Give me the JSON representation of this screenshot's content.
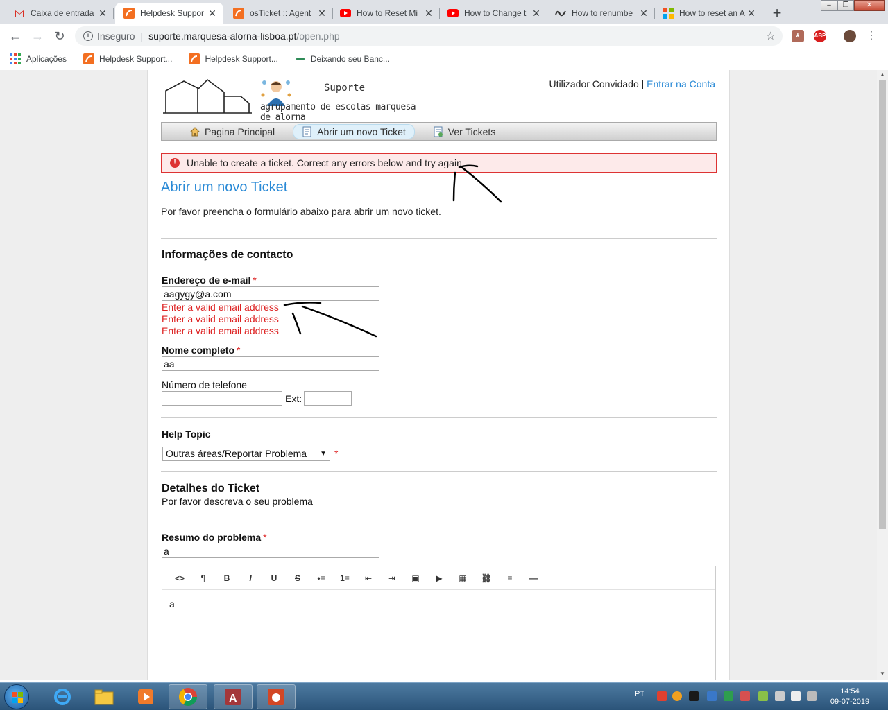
{
  "browser": {
    "tabs": [
      {
        "title": "Caixa de entrada",
        "icon": "gmail-icon",
        "active": false
      },
      {
        "title": "Helpdesk Suppor",
        "icon": "osticket-icon",
        "active": true
      },
      {
        "title": "osTicket :: Agent",
        "icon": "osticket-icon",
        "active": false
      },
      {
        "title": "How to Reset Mi",
        "icon": "youtube-icon",
        "active": false
      },
      {
        "title": "How to Change t",
        "icon": "youtube-icon",
        "active": false
      },
      {
        "title": "How to renumbe",
        "icon": "wave-icon",
        "active": false
      },
      {
        "title": "How to reset an A",
        "icon": "microsoft-icon",
        "active": false
      }
    ],
    "address": {
      "security_label": "Inseguro",
      "host": "suporte.marquesa-alorna-lisboa.pt",
      "path": "/open.php"
    },
    "bookmarks": [
      {
        "label": "Aplicações",
        "icon": "apps-icon"
      },
      {
        "label": "Helpdesk Support...",
        "icon": "osticket-icon"
      },
      {
        "label": "Helpdesk Support...",
        "icon": "osticket-icon"
      },
      {
        "label": "Deixando seu Banc...",
        "icon": "bank-icon"
      }
    ],
    "extensions": {
      "abp": "ABP"
    }
  },
  "header": {
    "logo_title": "Suporte",
    "logo_subtitle": "agrupamento de escolas marquesa de alorna",
    "user_label": "Utilizador Convidado",
    "separator": "|",
    "login_link": "Entrar na Conta"
  },
  "nav": [
    {
      "label": "Pagina Principal",
      "icon": "home-icon"
    },
    {
      "label": "Abrir um novo Ticket",
      "icon": "new-ticket-icon"
    },
    {
      "label": "Ver Tickets",
      "icon": "tickets-icon"
    }
  ],
  "error_banner": "Unable to create a ticket. Correct any errors below and try again.",
  "page": {
    "title": "Abrir um novo Ticket",
    "intro": "Por favor preencha o formulário abaixo para abrir um novo ticket."
  },
  "contact": {
    "heading": "Informações de contacto",
    "email_label": "Endereço de e-mail",
    "email_value": "aagygy@a.com",
    "email_errors": [
      "Enter a valid email address",
      "Enter a valid email address",
      "Enter a valid email address"
    ],
    "name_label": "Nome completo",
    "name_value": "aa",
    "phone_label": "Número de telefone",
    "phone_value": "",
    "ext_label": "Ext:",
    "ext_value": "",
    "required_mark": "*"
  },
  "help_topic": {
    "heading": "Help Topic",
    "selected": "Outras áreas/Reportar Problema"
  },
  "details": {
    "heading": "Detalhes do Ticket",
    "subheading": "Por favor descreva o seu problema",
    "summary_label": "Resumo do problema",
    "summary_value": "a",
    "editor_toolbar": [
      "<>",
      "¶",
      "B",
      "I",
      "U",
      "S",
      "•≡",
      "1≡",
      "⇤",
      "⇥",
      "▣",
      "▶",
      "▦",
      "⛓",
      "≡",
      "—"
    ],
    "editor_body": "a"
  },
  "taskbar": {
    "language": "PT",
    "time": "14:54",
    "date": "09-07-2019"
  }
}
